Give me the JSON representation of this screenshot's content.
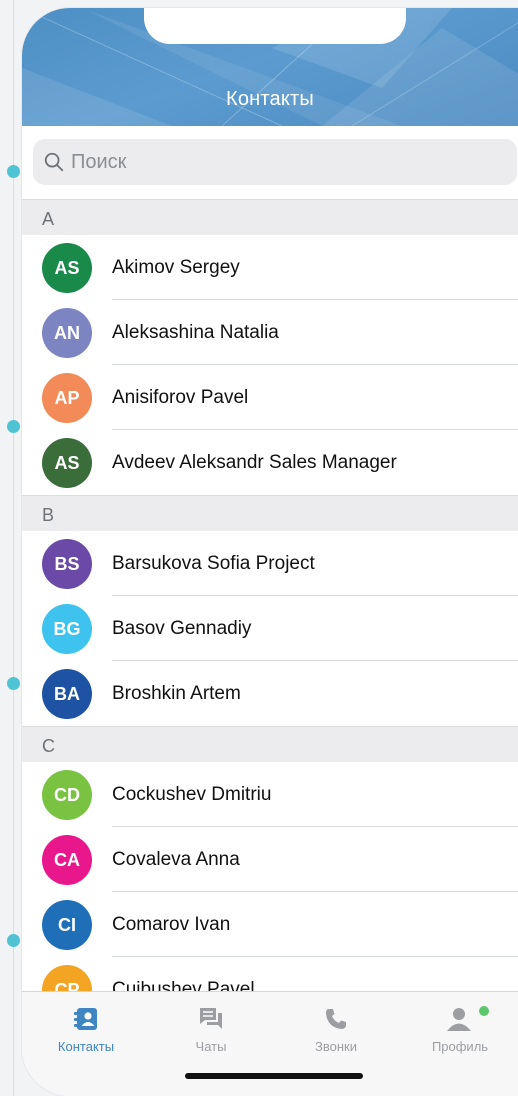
{
  "header": {
    "title": "Контакты"
  },
  "search": {
    "placeholder": "Поиск"
  },
  "sections": [
    {
      "letter": "A",
      "contacts": [
        {
          "initials": "AS",
          "name": "Akimov Sergey",
          "color": "#1a8a4b"
        },
        {
          "initials": "AN",
          "name": "Aleksashina Natalia",
          "color": "#7c85c2"
        },
        {
          "initials": "AP",
          "name": "Anisiforov Pavel",
          "color": "#f28b57"
        },
        {
          "initials": "AS",
          "name": "Avdeev Aleksandr Sales Manager",
          "color": "#3b6d3b"
        }
      ]
    },
    {
      "letter": "B",
      "contacts": [
        {
          "initials": "BS",
          "name": "Barsukova Sofia Project",
          "color": "#6a4aa6"
        },
        {
          "initials": "BG",
          "name": "Basov Gennadiy",
          "color": "#3ec3ee"
        },
        {
          "initials": "BA",
          "name": "Broshkin Artem",
          "color": "#1e53a3"
        }
      ]
    },
    {
      "letter": "C",
      "contacts": [
        {
          "initials": "CD",
          "name": "Cockushev Dmitriu",
          "color": "#7ac242"
        },
        {
          "initials": "CA",
          "name": "Covaleva Anna",
          "color": "#e8188c"
        },
        {
          "initials": "CI",
          "name": "Comarov Ivan",
          "color": "#1f6fb8"
        },
        {
          "initials": "CP",
          "name": "Cuibushev Pavel",
          "color": "#f4a423"
        }
      ]
    }
  ],
  "tabs": [
    {
      "id": "contacts",
      "label": "Контакты",
      "icon": "contacts-icon",
      "active": true
    },
    {
      "id": "chats",
      "label": "Чаты",
      "icon": "chat-icon",
      "active": false
    },
    {
      "id": "calls",
      "label": "Звонки",
      "icon": "phone-icon",
      "active": false
    },
    {
      "id": "profile",
      "label": "Профиль",
      "icon": "profile-icon",
      "active": false
    }
  ],
  "colors": {
    "accent": "#3e85c2",
    "header": "#4d8fc4",
    "online": "#5cc76b",
    "guide": "#4fc3d4"
  }
}
